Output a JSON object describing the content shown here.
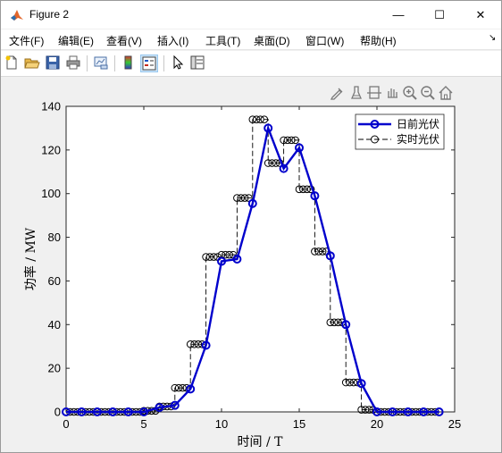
{
  "window": {
    "title": "Figure 2",
    "controls": {
      "minimize": "—",
      "maximize": "☐",
      "close": "✕"
    }
  },
  "menubar": {
    "items": [
      "文件(F)",
      "编辑(E)",
      "查看(V)",
      "插入(I)",
      "工具(T)",
      "桌面(D)",
      "窗口(W)",
      "帮助(H)"
    ],
    "overflow": "↘"
  },
  "toolbar": {
    "icons": [
      "new-figure-icon",
      "open-folder-icon",
      "save-icon",
      "print-icon",
      "link-plot-icon",
      "colorbar-icon",
      "legend-icon",
      "pointer-icon",
      "property-inspector-icon"
    ]
  },
  "axes_toolbar": {
    "icons": [
      "edit-plot-icon",
      "brush-icon",
      "data-tips-icon",
      "zoom-in-icon",
      "zoom-out-icon",
      "home-icon"
    ]
  },
  "chart_data": {
    "type": "line",
    "xlabel": "时间 / T",
    "ylabel": "功率 / MW",
    "xlim": [
      0,
      25
    ],
    "ylim": [
      0,
      140
    ],
    "xticks": [
      0,
      5,
      10,
      15,
      20,
      25
    ],
    "yticks": [
      0,
      20,
      40,
      60,
      80,
      100,
      120,
      140
    ],
    "grid": false,
    "legend_position": "top-right",
    "series": [
      {
        "name": "日前光伏",
        "style": "solid line with circle markers",
        "color": "#0000cc",
        "x": [
          0,
          1,
          2,
          3,
          4,
          5,
          6,
          7,
          8,
          9,
          10,
          11,
          12,
          13,
          14,
          15,
          16,
          17,
          18,
          19,
          20,
          21,
          22,
          23,
          24
        ],
        "values": [
          0,
          0,
          0,
          0,
          0,
          0,
          2,
          3,
          10.5,
          30.5,
          69,
          70,
          95.5,
          130,
          111.5,
          121,
          99,
          71.5,
          40,
          13,
          0,
          0,
          0,
          0,
          0
        ]
      },
      {
        "name": "实时光伏",
        "style": "dashed step line with circle markers",
        "color": "#000000",
        "x": [
          0,
          1,
          2,
          3,
          4,
          5,
          6,
          7,
          8,
          9,
          10,
          11,
          12,
          13,
          14,
          15,
          16,
          17,
          18,
          19,
          20,
          21,
          22,
          23,
          24
        ],
        "values": [
          0,
          0,
          0,
          0,
          0,
          0.5,
          2.5,
          11,
          31,
          71,
          72,
          98,
          134,
          114,
          124.5,
          102,
          73.5,
          41,
          13.5,
          1,
          0,
          0,
          0,
          0,
          0
        ]
      }
    ]
  },
  "colors": {
    "accent_blue": "#0000cc",
    "titlebar": "#ffffff",
    "canvas": "#f0f0f0"
  }
}
